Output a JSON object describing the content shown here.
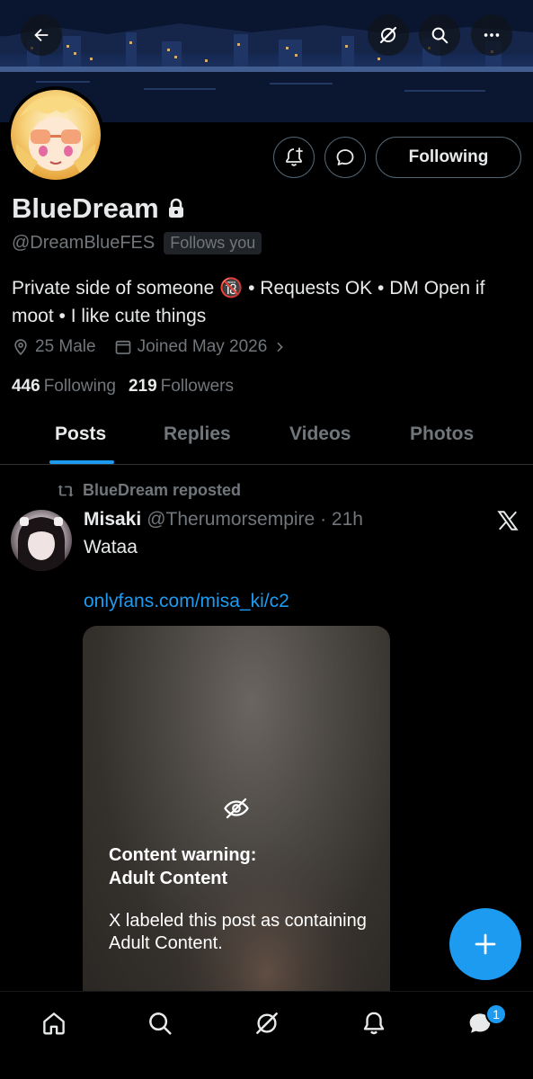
{
  "header": {
    "back_icon": "arrow-left-icon",
    "grok_icon": "grok-slash-icon",
    "search_icon": "search-icon",
    "more_icon": "more-horizontal-icon"
  },
  "profile": {
    "name": "BlueDream",
    "handle": "@DreamBlueFES",
    "follows_you": "Follows you",
    "bio": "Private side of someone 🔞 • Requests OK • DM Open if moot • I like cute things",
    "location": "25 Male",
    "joined": "Joined May 2026",
    "following_count": "446",
    "following_label": "Following",
    "followers_count": "219",
    "followers_label": "Followers",
    "following_button": "Following"
  },
  "tabs": [
    {
      "label": "Posts",
      "active": true
    },
    {
      "label": "Replies",
      "active": false
    },
    {
      "label": "Videos",
      "active": false
    },
    {
      "label": "Photos",
      "active": false
    }
  ],
  "post": {
    "repost_label": "BlueDream reposted",
    "author_name": "Misaki",
    "author_handle": "@Therumorsempire · 21h",
    "text": "Wataa",
    "link": "onlyfans.com/misa_ki/c2",
    "warning_title": "Content warning:\nAdult Content",
    "warning_title_line1": "Content warning:",
    "warning_title_line2": "Adult Content",
    "warning_body": "X labeled this post as containing Adult Content."
  },
  "nav": {
    "messages_badge": "1"
  },
  "colors": {
    "accent": "#1d9bf0",
    "background": "#000000",
    "secondary_text": "#71767b",
    "primary_text": "#e7e9ea"
  }
}
